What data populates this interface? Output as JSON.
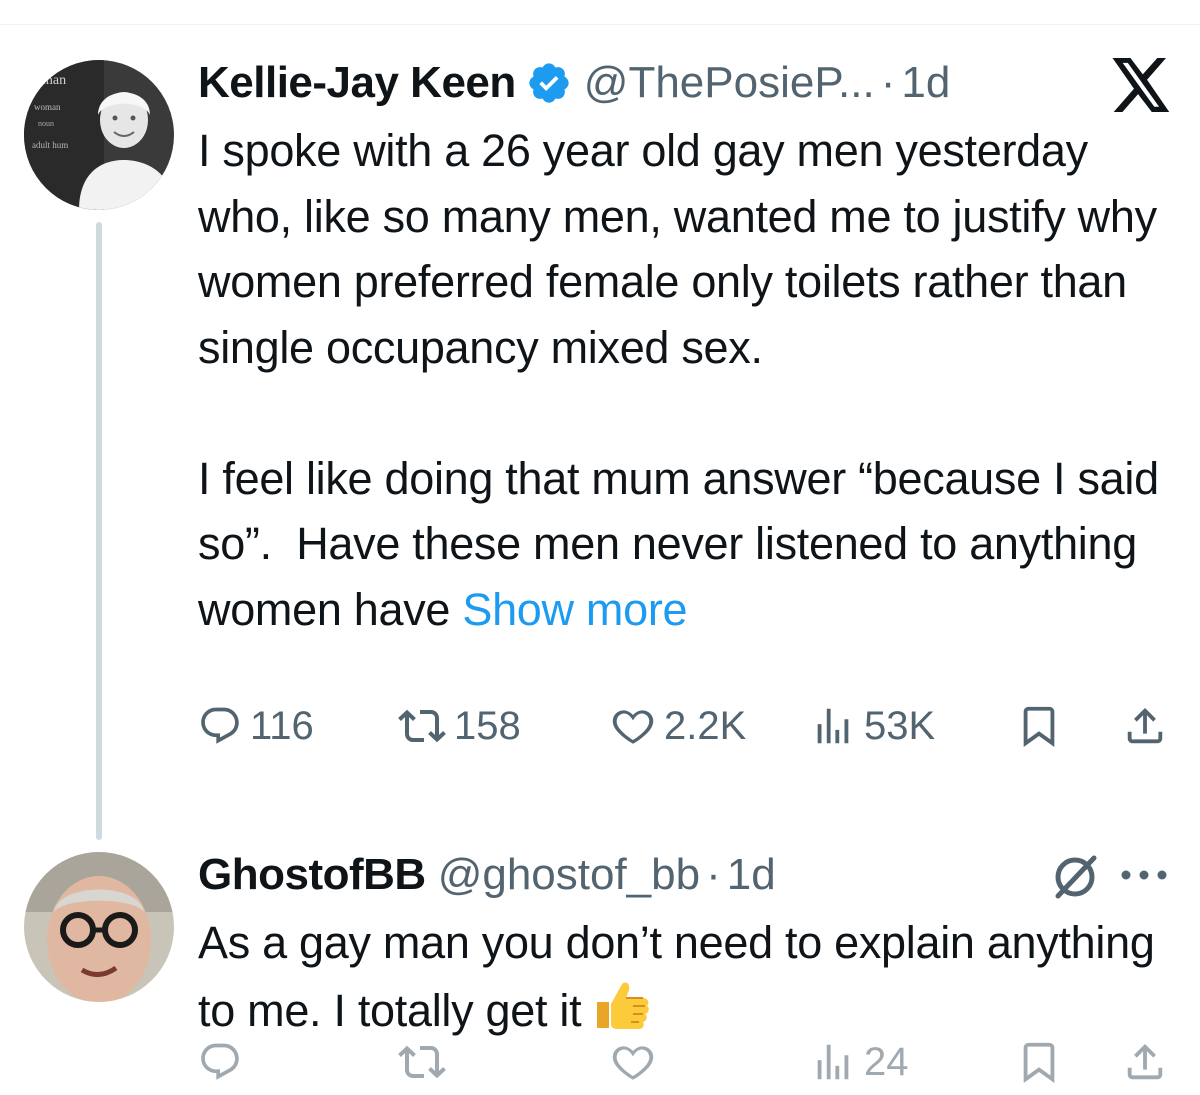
{
  "colors": {
    "accent": "#1d9bf0",
    "text": "#0f1419",
    "muted": "#536471",
    "thread": "#cfd9de",
    "background": "#ffffff"
  },
  "tweets": [
    {
      "name": "Kellie-Jay Keen",
      "verified": true,
      "handle": "@ThePosieP...",
      "dot": "·",
      "time": "1d",
      "text": "I spoke with a 26 year old gay men yesterday who, like so many men, wanted me to justify why women preferred female only toilets rather than single occupancy mixed sex.\n\nI feel like doing that mum answer “because I said so”.  Have these men never listened to anything women have ",
      "show_more": "Show more",
      "avatar_text": [
        "man",
        "woman",
        "noun",
        "adult hum"
      ],
      "header_icon": "x-logo-icon",
      "stats": {
        "replies": "116",
        "reposts": "158",
        "likes": "2.2K",
        "views": "53K"
      }
    },
    {
      "name": "GhostofBB",
      "verified": false,
      "handle": "@ghostof_bb",
      "dot": "·",
      "time": "1d",
      "text": "As a gay man you don’t need to explain anything to me. I totally get it ",
      "emoji_icon": "thumbs-up-icon",
      "header_icons": [
        "grok-icon",
        "more-icon"
      ],
      "stats": {
        "views": "24"
      }
    }
  ]
}
